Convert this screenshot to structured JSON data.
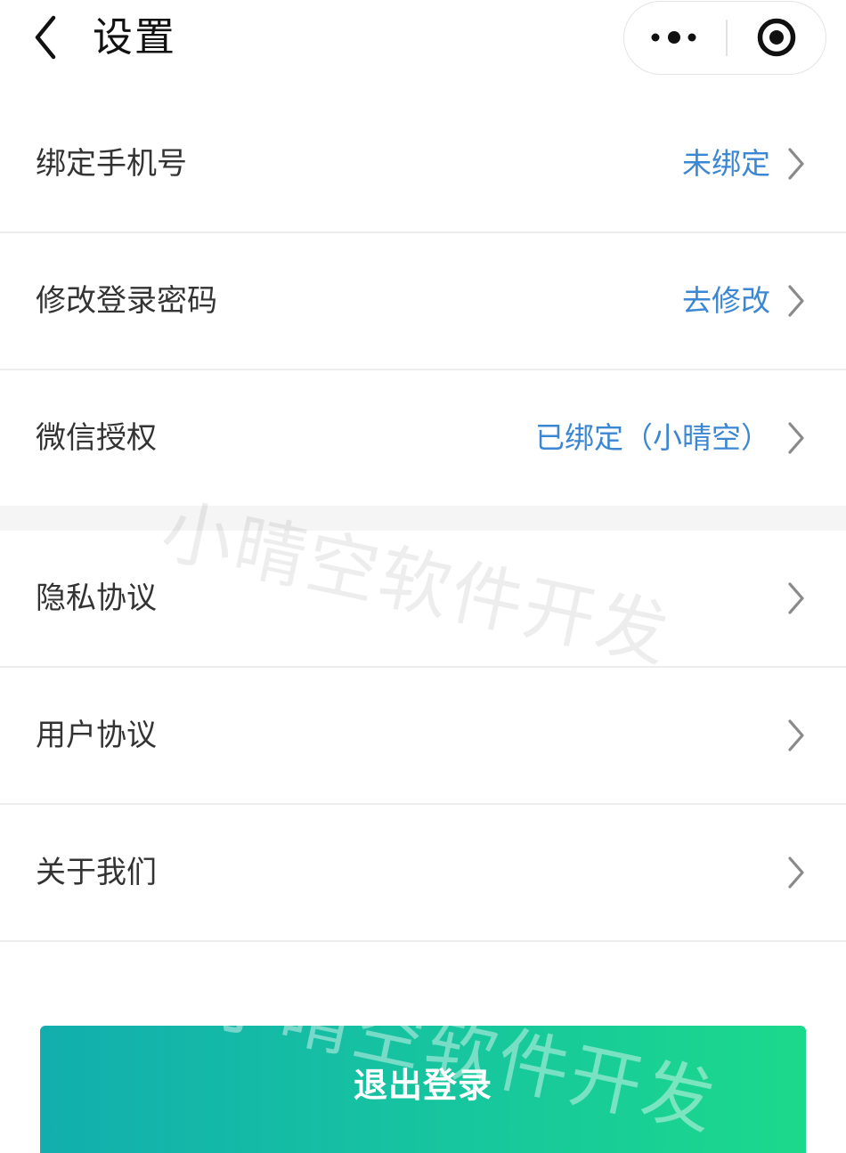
{
  "nav": {
    "title": "设置",
    "icons": {
      "back": "chevron-left-icon",
      "more": "more-dots-icon",
      "home": "target-icon"
    }
  },
  "settings": {
    "group1": [
      {
        "label": "绑定手机号",
        "value": "未绑定"
      },
      {
        "label": "修改登录密码",
        "value": "去修改"
      },
      {
        "label": "微信授权",
        "value": "已绑定（小晴空）"
      }
    ],
    "group2": [
      {
        "label": "隐私协议"
      },
      {
        "label": "用户协议"
      },
      {
        "label": "关于我们"
      }
    ],
    "row_icon": "chevron-right-icon"
  },
  "logout": {
    "label": "退出登录"
  },
  "watermark": {
    "text": "小晴空软件开发"
  },
  "colors": {
    "value_text": "#3b87d3",
    "label_text": "#333333",
    "button_gradient_start": "#12aeae",
    "button_gradient_end": "#1bd98b",
    "button_text": "#ffffff"
  }
}
